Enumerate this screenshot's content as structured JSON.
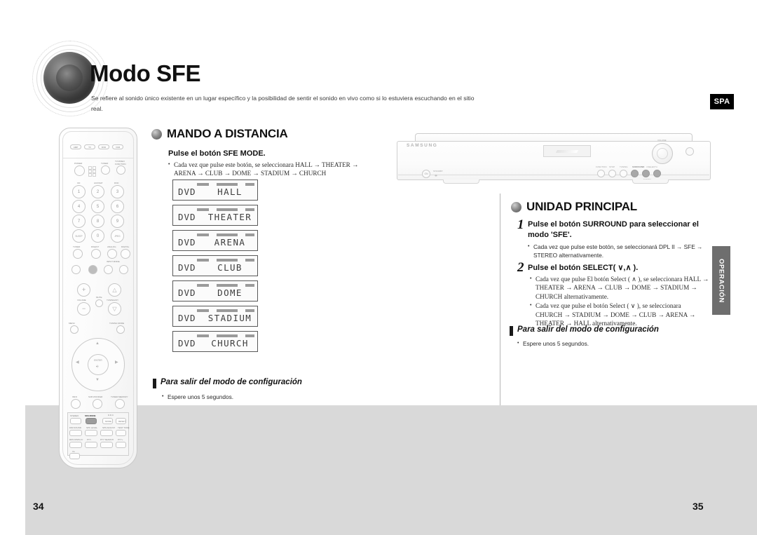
{
  "header": {
    "title": "Modo SFE",
    "subtitle": "Se refiere al sonido único existente en un lugar específico y la posibilidad de sentir el sonido en vivo como si lo estuviera escuchando en el sitio real.",
    "language_badge": "SPA",
    "side_tab": "OPERACIÓN"
  },
  "left_page": {
    "page_number": "34",
    "section": {
      "heading": "MANDO A DISTANCIA",
      "step_title": "Pulse el botón SFE MODE.",
      "bullets": [
        "Cada vez que pulse este botón, se seleccionara HALL → THEATER → ARENA → CLUB → DOME → STADIUM → CHURCH alternativamente."
      ]
    },
    "lcd_panels": [
      {
        "source": "DVD",
        "mode": "HALL"
      },
      {
        "source": "DVD",
        "mode": "THEATER"
      },
      {
        "source": "DVD",
        "mode": "ARENA"
      },
      {
        "source": "DVD",
        "mode": "CLUB"
      },
      {
        "source": "DVD",
        "mode": "DOME"
      },
      {
        "source": "DVD",
        "mode": "STADIUM"
      },
      {
        "source": "DVD",
        "mode": "CHURCH"
      }
    ],
    "exit": {
      "heading": "Para salir del modo de configuración",
      "bullet": "Espere unos 5 segundos."
    }
  },
  "right_page": {
    "page_number": "35",
    "section": {
      "heading": "UNIDAD PRINCIPAL",
      "steps": [
        {
          "number": "1",
          "title": "Pulse el botón SURROUND para seleccionar el modo 'SFE'.",
          "bullets": [
            "Cada vez que pulse este botón, se seleccionará DPL II → SFE → STEREO alternativamente."
          ]
        },
        {
          "number": "2",
          "title": "Pulse el botón SELECT( ∨,∧ ).",
          "bullets": [
            "Cada vez que pulse El botón Select ( ∧ ), se seleccionara HALL → THEATER → ARENA → CLUB → DOME → STADIUM → CHURCH alternativamente.",
            "Cada vez que pulse el botón Select ( ∨ ), se seleccionara CHURCH → STADIUM → DOME → CLUB → ARENA → THEATER → HALL alternativamente."
          ]
        }
      ]
    },
    "exit": {
      "heading": "Para salir del modo de configuración",
      "bullet": "Espere unos 5 segundos."
    }
  },
  "remote": {
    "source_buttons": [
      "AMP",
      "TV",
      "DVD",
      "VCR"
    ],
    "power_label": "POWER",
    "tuner_label": "TUNER",
    "tv_video_label": "TV/VIDEO",
    "function_label": "FUNCTION",
    "number_labels": {
      "cd": "CD",
      "aux": "AUX/SAT",
      "dvd": "DVD"
    },
    "keys": [
      "1",
      "2",
      "3",
      "4",
      "5",
      "6",
      "7",
      "8",
      "9",
      "0"
    ],
    "sleep_label": "SLEEP",
    "jpeg_label": "JPEG",
    "row_labels": [
      "TUNER",
      "DIGEST",
      "ANALOG",
      "DIGITAL"
    ],
    "input_mode_label": "INPUT MODE",
    "volume_label": "VOLUME",
    "mute_label": "MUTE",
    "tuning_label": "TUNING/CH",
    "menu_label": "MENU",
    "tuning_mode_label": "TUNING MODE",
    "enter_label": "ENTER",
    "bottom_labels": [
      "INFO",
      "SUB WOOFER",
      "TUNER MEMORY"
    ],
    "sfe_rows": [
      [
        "STEREO",
        "SFE MODE",
        "D.R.C",
        "MODE",
        "RESET"
      ],
      [
        "DIM.SOUND",
        "SPK LEVEL",
        "SPK ADJUST",
        "TEST TONE"
      ],
      [
        "RDS DISPLAY",
        "PTY-",
        "PTY SEARCH",
        "PTY+"
      ],
      [
        "TA"
      ]
    ]
  },
  "main_unit": {
    "brand": "SAMSUNG",
    "power_label": "ON",
    "standby_label": "STANDBY",
    "control_labels": [
      "FUNCTION",
      "STOP",
      "TUNING",
      "SURROUND",
      "SELECT"
    ],
    "volume_label": "VOLUME"
  }
}
